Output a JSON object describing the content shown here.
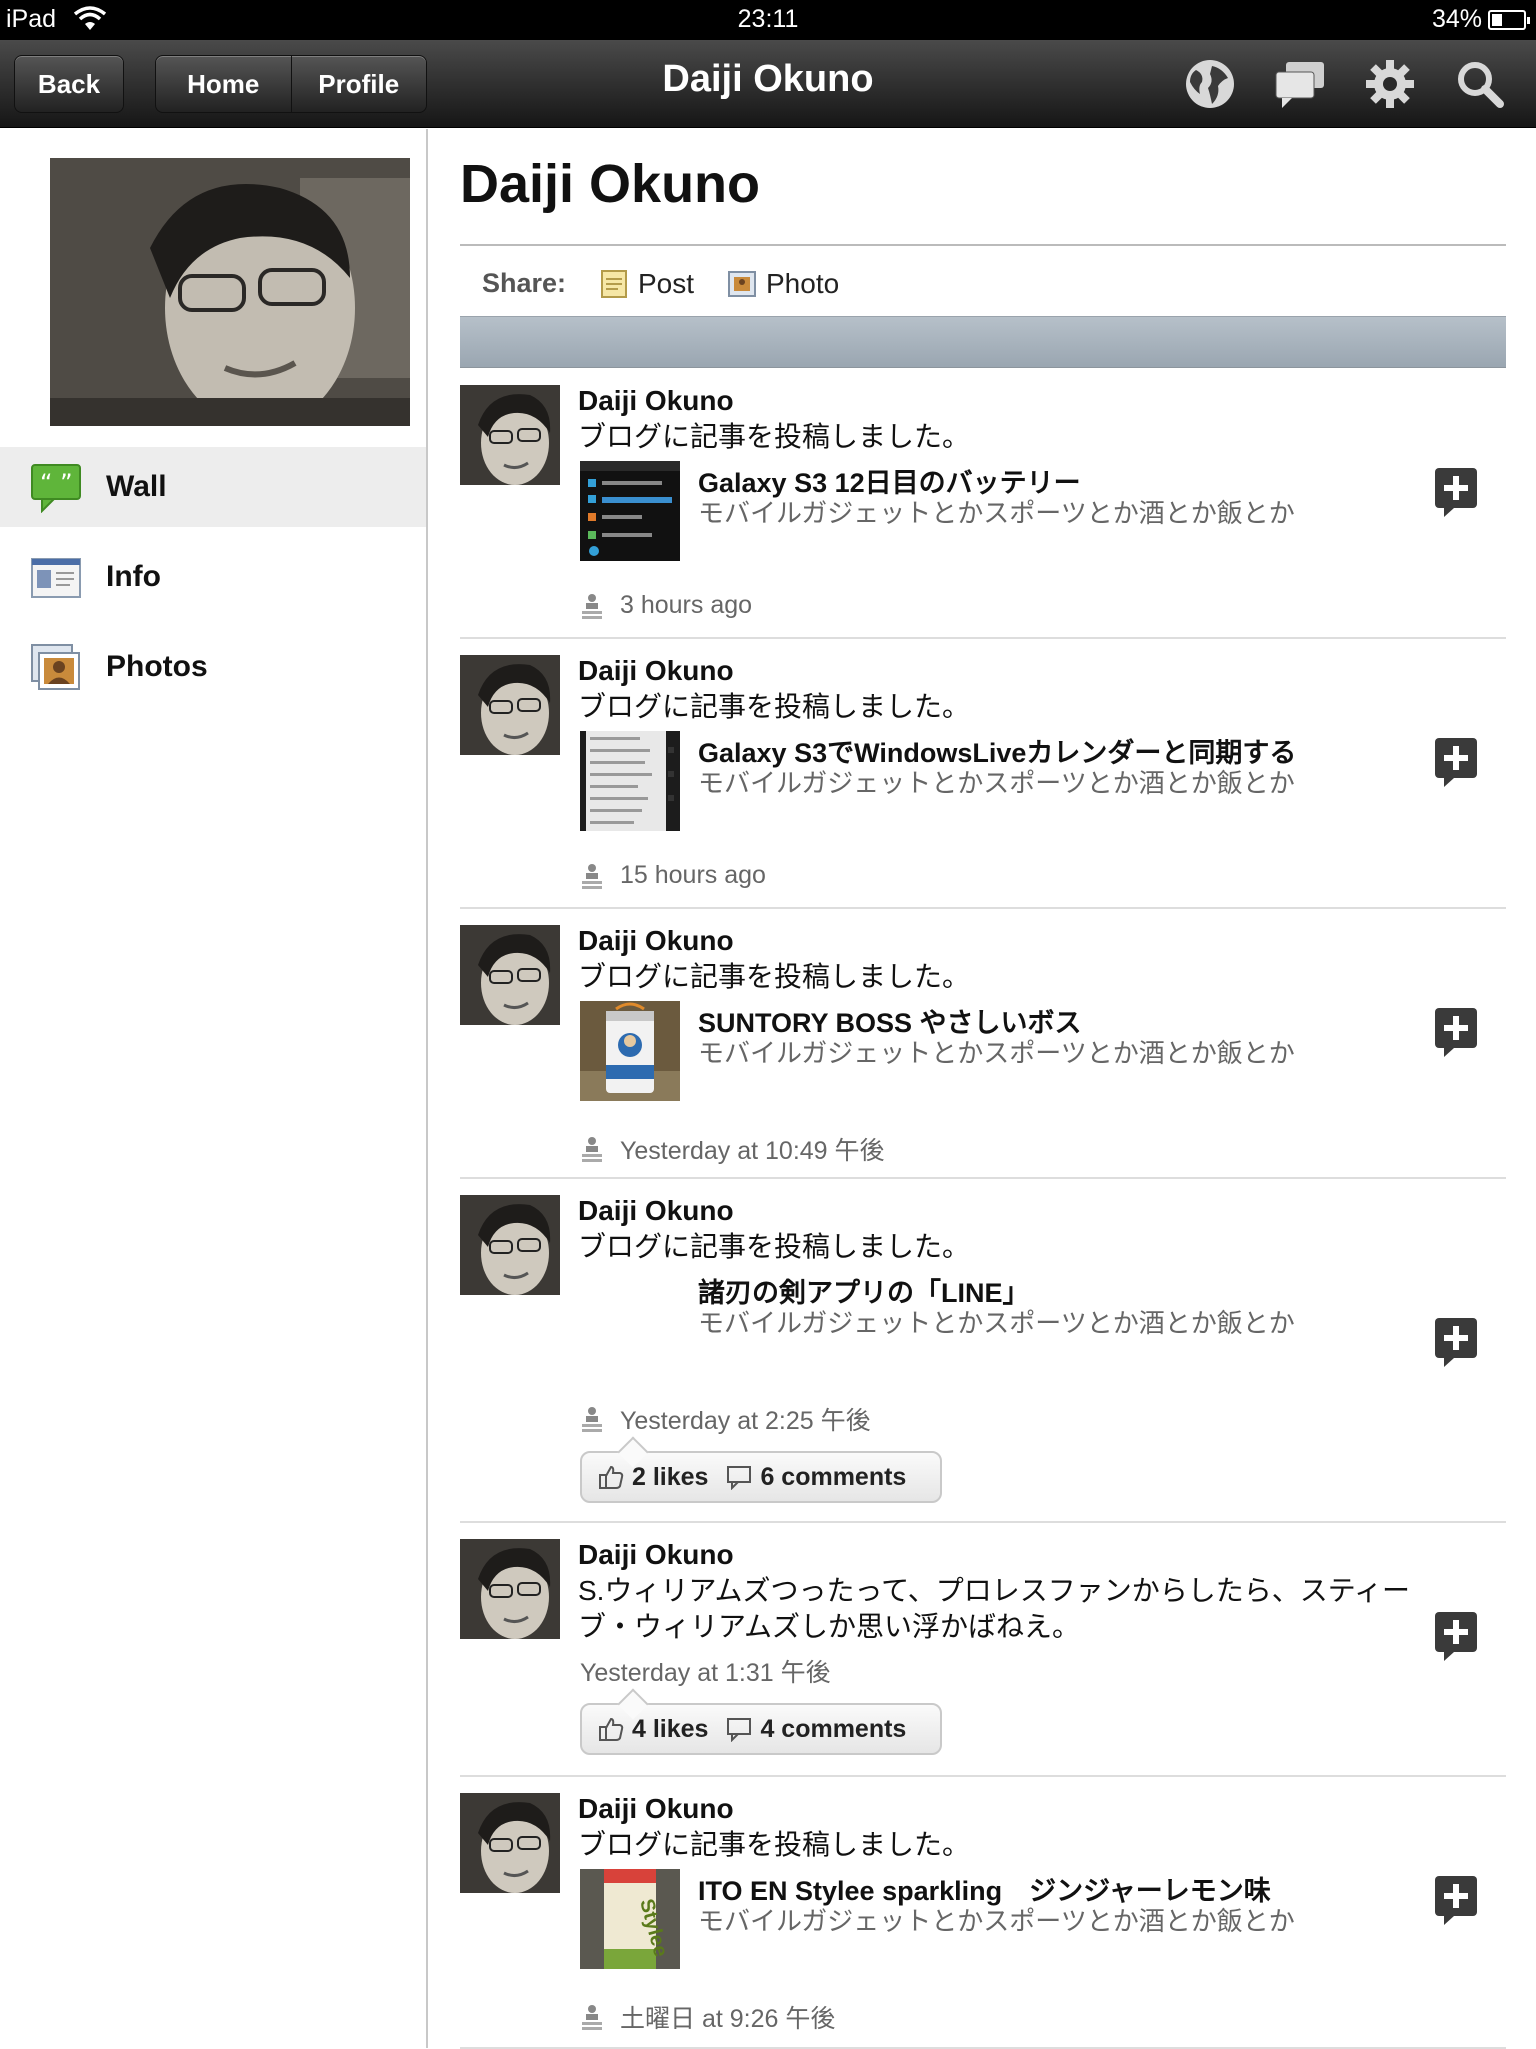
{
  "status_bar": {
    "carrier": "iPad",
    "time": "23:11",
    "battery": "34%"
  },
  "nav": {
    "back": "Back",
    "home": "Home",
    "profile": "Profile",
    "title": "Daiji Okuno",
    "icons": [
      "globe-icon",
      "chat-bubbles-icon",
      "gear-icon",
      "search-icon"
    ]
  },
  "sidebar": {
    "items": [
      {
        "label": "Wall",
        "icon": "speech-bubble-icon",
        "active": true
      },
      {
        "label": "Info",
        "icon": "info-card-icon",
        "active": false
      },
      {
        "label": "Photos",
        "icon": "photos-icon",
        "active": false
      }
    ]
  },
  "main": {
    "title": "Daiji Okuno",
    "share": {
      "label": "Share:",
      "post": "Post",
      "photo": "Photo"
    }
  },
  "posts": [
    {
      "author": "Daiji Okuno",
      "text": "ブログに記事を投稿しました。",
      "link_title": "Galaxy S3 12日目のバッテリー",
      "link_desc": "モバイルガジェットとかスポーツとか酒とか飯とか",
      "time": "3 hours ago"
    },
    {
      "author": "Daiji Okuno",
      "text": "ブログに記事を投稿しました。",
      "link_title": "Galaxy S3でWindowsLiveカレンダーと同期する",
      "link_desc": "モバイルガジェットとかスポーツとか酒とか飯とか",
      "time": "15 hours ago"
    },
    {
      "author": "Daiji Okuno",
      "text": "ブログに記事を投稿しました。",
      "link_title": "SUNTORY BOSS やさしいボス",
      "link_desc": "モバイルガジェットとかスポーツとか酒とか飯とか",
      "time": "Yesterday at 10:49 午後"
    },
    {
      "author": "Daiji Okuno",
      "text": "ブログに記事を投稿しました。",
      "link_title": "諸刃の剣アプリの「LINE」",
      "link_desc": "モバイルガジェットとかスポーツとか酒とか飯とか",
      "time": "Yesterday at 2:25 午後",
      "likes": "2 likes",
      "comments": "6 comments"
    },
    {
      "author": "Daiji Okuno",
      "text": "S.ウィリアムズつったって、プロレスファンからしたら、スティーブ・ウィリアムズしか思い浮かばねえ。",
      "time": "Yesterday at 1:31 午後",
      "likes": "4 likes",
      "comments": "4 comments"
    },
    {
      "author": "Daiji Okuno",
      "text": "ブログに記事を投稿しました。",
      "link_title": "ITO EN  Stylee sparkling　ジンジャーレモン味",
      "link_desc": "モバイルガジェットとかスポーツとか酒とか飯とか",
      "time": "土曜日 at 9:26 午後"
    }
  ]
}
